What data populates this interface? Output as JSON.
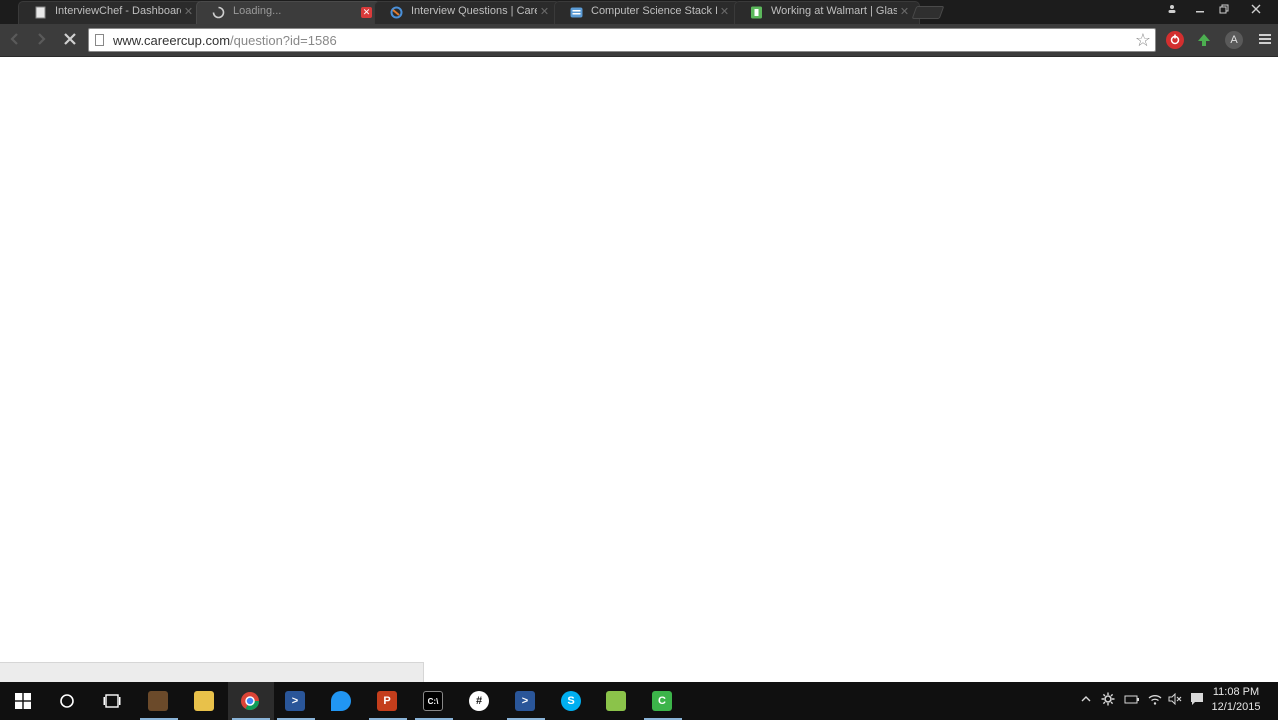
{
  "browser": {
    "tabs": [
      {
        "title": "InterviewChef - Dashboard",
        "icon": "page-icon",
        "active": false
      },
      {
        "title": "Loading...",
        "icon": "loading-spinner-icon",
        "active": true
      },
      {
        "title": "Interview Questions | CareerCup",
        "icon": "careercup-icon",
        "active": false
      },
      {
        "title": "Computer Science Stack Exchange",
        "icon": "stackexchange-icon",
        "active": false
      },
      {
        "title": "Working at Walmart | Glassdoor",
        "icon": "glassdoor-icon",
        "active": false
      }
    ],
    "address_bar": {
      "domain": "www.careercup.com",
      "path": "/question?id=1586"
    }
  },
  "taskbar": {
    "clock_time": "11:08 PM",
    "clock_date": "12/1/2015"
  },
  "colors": {
    "tab_close_active": "#d93b3b",
    "taskbar_bg": "#101010",
    "chrome_toolbar": "#3c3c3c"
  }
}
